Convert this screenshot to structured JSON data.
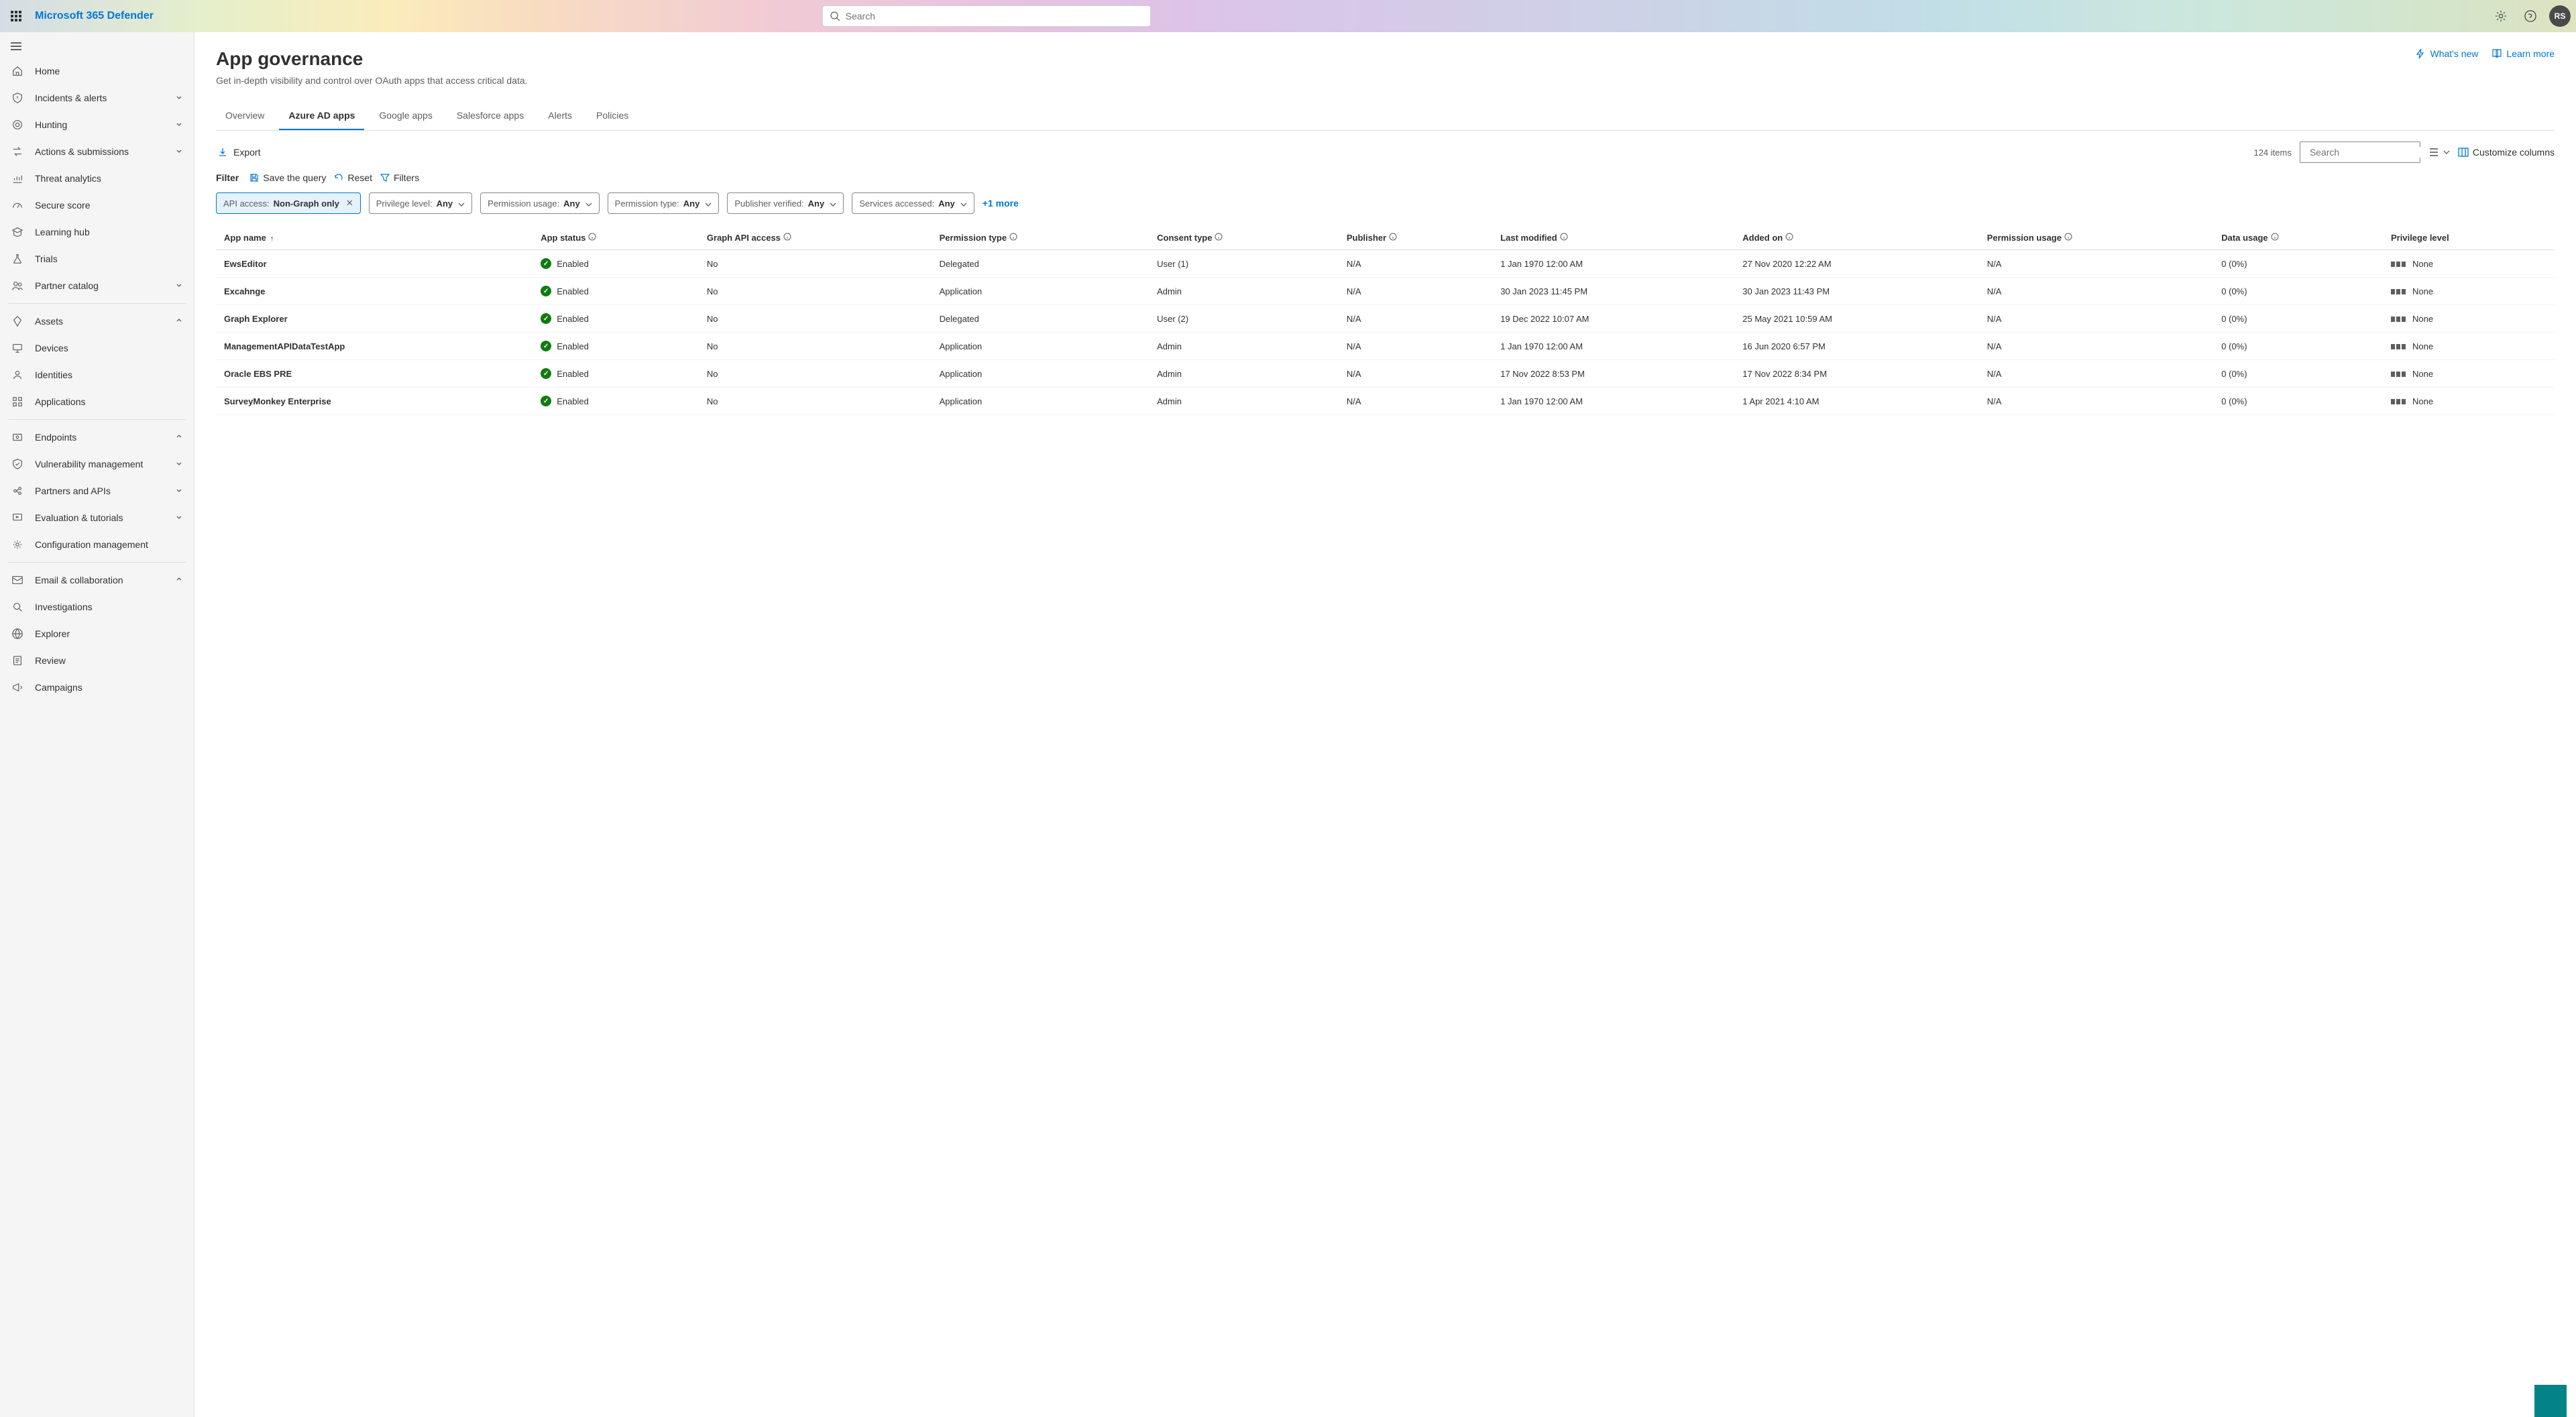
{
  "header": {
    "brand": "Microsoft 365 Defender",
    "search_placeholder": "Search",
    "avatar_initials": "RS"
  },
  "sidebar": {
    "items": [
      {
        "icon": "home",
        "label": "Home",
        "expandable": false
      },
      {
        "icon": "shield-alert",
        "label": "Incidents & alerts",
        "expandable": true
      },
      {
        "icon": "target",
        "label": "Hunting",
        "expandable": true
      },
      {
        "icon": "swap",
        "label": "Actions & submissions",
        "expandable": true
      },
      {
        "icon": "analytics",
        "label": "Threat analytics",
        "expandable": false
      },
      {
        "icon": "gauge",
        "label": "Secure score",
        "expandable": false
      },
      {
        "icon": "learn",
        "label": "Learning hub",
        "expandable": false
      },
      {
        "icon": "flask",
        "label": "Trials",
        "expandable": false
      },
      {
        "icon": "people",
        "label": "Partner catalog",
        "expandable": true
      },
      {
        "divider": true
      },
      {
        "icon": "diamond",
        "label": "Assets",
        "expandable": true,
        "expanded": true
      },
      {
        "icon": "device",
        "label": "Devices",
        "indent": true
      },
      {
        "icon": "person",
        "label": "Identities",
        "indent": true
      },
      {
        "icon": "apps",
        "label": "Applications",
        "indent": true
      },
      {
        "divider": true
      },
      {
        "icon": "endpoint",
        "label": "Endpoints",
        "expandable": true,
        "expanded": true
      },
      {
        "icon": "vuln",
        "label": "Vulnerability management",
        "expandable": true
      },
      {
        "icon": "api",
        "label": "Partners and APIs",
        "expandable": true
      },
      {
        "icon": "tutorial",
        "label": "Evaluation & tutorials",
        "expandable": true
      },
      {
        "icon": "config",
        "label": "Configuration management",
        "expandable": false
      },
      {
        "divider": true
      },
      {
        "icon": "mail",
        "label": "Email & collaboration",
        "expandable": true,
        "expanded": true
      },
      {
        "icon": "investigate",
        "label": "Investigations",
        "expandable": false
      },
      {
        "icon": "explorer",
        "label": "Explorer",
        "expandable": false
      },
      {
        "icon": "review",
        "label": "Review",
        "expandable": false
      },
      {
        "icon": "campaign",
        "label": "Campaigns",
        "expandable": false
      }
    ]
  },
  "page": {
    "title": "App governance",
    "subtitle": "Get in-depth visibility and control over OAuth apps that access critical data.",
    "whats_new": "What's new",
    "learn_more": "Learn more"
  },
  "tabs": [
    "Overview",
    "Azure AD apps",
    "Google apps",
    "Salesforce apps",
    "Alerts",
    "Policies"
  ],
  "active_tab": 1,
  "toolbar": {
    "export": "Export",
    "item_count": "124 items",
    "search_placeholder": "Search",
    "customize": "Customize columns"
  },
  "filter_bar": {
    "filter_label": "Filter",
    "save_query": "Save the query",
    "reset": "Reset",
    "filters": "Filters"
  },
  "chips": [
    {
      "label": "API access:",
      "value": "Non-Graph only",
      "active": true,
      "removable": true
    },
    {
      "label": "Privilege level:",
      "value": "Any"
    },
    {
      "label": "Permission usage:",
      "value": "Any"
    },
    {
      "label": "Permission type:",
      "value": "Any"
    },
    {
      "label": "Publisher verified:",
      "value": "Any"
    },
    {
      "label": "Services accessed:",
      "value": "Any"
    }
  ],
  "more_filters": "+1 more",
  "columns": [
    "App name",
    "App status",
    "Graph API access",
    "Permission type",
    "Consent type",
    "Publisher",
    "Last modified",
    "Added on",
    "Permission usage",
    "Data usage",
    "Privilege level"
  ],
  "column_info": [
    false,
    true,
    true,
    true,
    true,
    true,
    true,
    true,
    true,
    true,
    false
  ],
  "sort_column": 0,
  "rows": [
    {
      "name": "EwsEditor",
      "status": "Enabled",
      "graph_access": "No",
      "perm_type": "Delegated",
      "consent": "User (1)",
      "publisher": "N/A",
      "last_mod": "1 Jan 1970 12:00 AM",
      "added": "27 Nov 2020 12:22 AM",
      "perm_usage": "N/A",
      "data_usage": "0 (0%)",
      "priv": "None"
    },
    {
      "name": "Excahnge",
      "status": "Enabled",
      "graph_access": "No",
      "perm_type": "Application",
      "consent": "Admin",
      "publisher": "N/A",
      "last_mod": "30 Jan 2023 11:45 PM",
      "added": "30 Jan 2023 11:43 PM",
      "perm_usage": "N/A",
      "data_usage": "0 (0%)",
      "priv": "None"
    },
    {
      "name": "Graph Explorer",
      "status": "Enabled",
      "graph_access": "No",
      "perm_type": "Delegated",
      "consent": "User (2)",
      "publisher": "N/A",
      "last_mod": "19 Dec 2022 10:07 AM",
      "added": "25 May 2021 10:59 AM",
      "perm_usage": "N/A",
      "data_usage": "0 (0%)",
      "priv": "None"
    },
    {
      "name": "ManagementAPIDataTestApp",
      "status": "Enabled",
      "graph_access": "No",
      "perm_type": "Application",
      "consent": "Admin",
      "publisher": "N/A",
      "last_mod": "1 Jan 1970 12:00 AM",
      "added": "16 Jun 2020 6:57 PM",
      "perm_usage": "N/A",
      "data_usage": "0 (0%)",
      "priv": "None"
    },
    {
      "name": "Oracle EBS PRE",
      "status": "Enabled",
      "graph_access": "No",
      "perm_type": "Application",
      "consent": "Admin",
      "publisher": "N/A",
      "last_mod": "17 Nov 2022 8:53 PM",
      "added": "17 Nov 2022 8:34 PM",
      "perm_usage": "N/A",
      "data_usage": "0 (0%)",
      "priv": "None"
    },
    {
      "name": "SurveyMonkey Enterprise",
      "status": "Enabled",
      "graph_access": "No",
      "perm_type": "Application",
      "consent": "Admin",
      "publisher": "N/A",
      "last_mod": "1 Jan 1970 12:00 AM",
      "added": "1 Apr 2021 4:10 AM",
      "perm_usage": "N/A",
      "data_usage": "0 (0%)",
      "priv": "None"
    }
  ]
}
